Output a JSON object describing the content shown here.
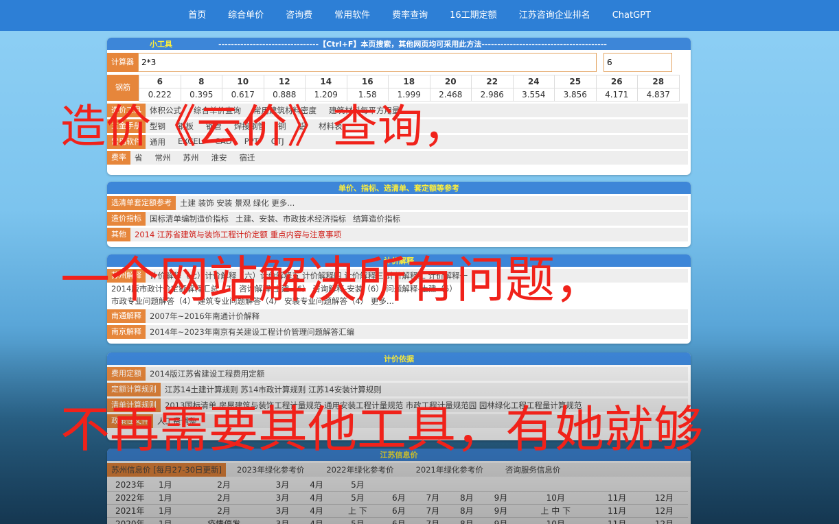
{
  "nav": [
    "首页",
    "综合单价",
    "咨询费",
    "常用软件",
    "费率查询",
    "16工期定额",
    "江苏咨询企业排名",
    "ChatGPT"
  ],
  "tools": {
    "tag": "小工具",
    "search_hint": "--------------------------------【Ctrl+F】本页搜索，其他网页均可采用此方法----------------------------------------",
    "calc_label": "计算器",
    "calc_expr": "2*3",
    "calc_result": "6",
    "steel_label": "钢筋",
    "steel_sizes": [
      "6",
      "8",
      "10",
      "12",
      "14",
      "16",
      "18",
      "20",
      "22",
      "24",
      "25",
      "26",
      "28"
    ],
    "steel_weights": [
      "0.222",
      "0.395",
      "0.617",
      "0.888",
      "1.209",
      "1.58",
      "1.999",
      "2.468",
      "2.986",
      "3.554",
      "3.856",
      "4.171",
      "4.837"
    ],
    "rows": [
      {
        "tag": "造价工具",
        "items": [
          "体积公式",
          "综合单价查询",
          "常用建筑材料密度",
          "建筑材料每平方用量"
        ]
      },
      {
        "tag": "五金手册",
        "items": [
          "型钢",
          "钢板",
          "钢管",
          "焊接钢管",
          "铜",
          "铝",
          "材料表"
        ]
      },
      {
        "tag": "常用软件",
        "items": [
          "通用",
          "EXCEL",
          "CAD",
          "PPT",
          "GTJ"
        ]
      },
      {
        "tag": "费率",
        "items": [
          "省",
          "常州",
          "苏州",
          "淮安",
          "宿迁"
        ]
      }
    ]
  },
  "ref": {
    "title": "单价、指标、选清单、套定额等参考",
    "rows": [
      {
        "tag": "选清单套定额参考",
        "items": [
          "土建 装饰 安装 景观 绿化 更多..."
        ],
        "red": false
      },
      {
        "tag": "造价指标",
        "items": [
          "国标清单编制造价指标",
          "土建、安装、市政技术经济指标",
          "结算造价指标"
        ],
        "red": false
      },
      {
        "tag": "其他",
        "items": [
          "2014 江苏省建筑与装饰工程计价定额 重点内容与注意事项"
        ],
        "red": true
      }
    ]
  },
  "explain": {
    "title": "计价解释",
    "row1_tag": "苏州解释",
    "row1_text": "计价解释（七）计价解释（六）计价解释五 计价解释四 计价解释三 计价解释二 计价解释一",
    "line2": "2014版市政计价定额解释汇总（7）咨询解释-土建（6） 咨询解释-安装（6） 问题解释-土建（5）",
    "line3": "市政专业问题解答（4） 建筑专业问题解答（4） 安装专业问题解答（4） 更多...",
    "rows": [
      {
        "tag": "南通解释",
        "text": "2007年~2016年南通计价解释"
      },
      {
        "tag": "南京解释",
        "text": "2014年~2023年南京有关建设工程计价管理问题解答汇编"
      }
    ]
  },
  "basis": {
    "title": "计价依据",
    "rows": [
      {
        "tag": "费用定额",
        "text": "2014版江苏省建设工程费用定额"
      },
      {
        "tag": "定额计算规则",
        "text": "江苏14土建计算规则   苏14市政计算规则   江苏14安装计算规则"
      },
      {
        "tag": "清单计算规则",
        "text": "2013国标清单  房屋建筑与装饰工程计量规范  通用安装工程计量规范  市政工程计量规范园  园林绿化工程工程量计算规范"
      },
      {
        "tag": "政策性文件",
        "text": "人工费调整"
      }
    ]
  },
  "info": {
    "title": "江苏信息价",
    "tabs": [
      "苏州信息价 [每月27-30日更新]",
      "2023年绿化参考价",
      "2022年绿化参考价",
      "2021年绿化参考价",
      "咨询服务信息价"
    ],
    "rows": [
      {
        "year": "2023年",
        "months": [
          "1月",
          "2月",
          "3月",
          "4月",
          "5月",
          "",
          "",
          "",
          "",
          "",
          "",
          ""
        ]
      },
      {
        "year": "2022年",
        "months": [
          "1月",
          "2月",
          "3月",
          "4月",
          "5月",
          "6月",
          "7月",
          "8月",
          "9月",
          "10月",
          "11月",
          "12月"
        ]
      },
      {
        "year": "2021年",
        "months": [
          "1月",
          "2月",
          "3月",
          "4月",
          "上 下",
          "6月",
          "7月",
          "8月",
          "9月",
          "上 中 下",
          "11月",
          "12月"
        ]
      },
      {
        "year": "2020年",
        "months": [
          "1月",
          "疫情停发",
          "3月",
          "4月",
          "5月",
          "6月",
          "7月",
          "8月",
          "9月",
          "10月",
          "11月",
          "12月"
        ]
      }
    ]
  },
  "captions": {
    "line1": "造价《云价》查询，",
    "line2": "一个网站解决所有问题，",
    "line3": "不再需要其他工具，有她就够"
  },
  "colors": {
    "nav_bg": "#2d7fd6",
    "panel_head": "#3d86d8",
    "tag_orange": "#e6863b",
    "caption_red": "#f0221a"
  }
}
